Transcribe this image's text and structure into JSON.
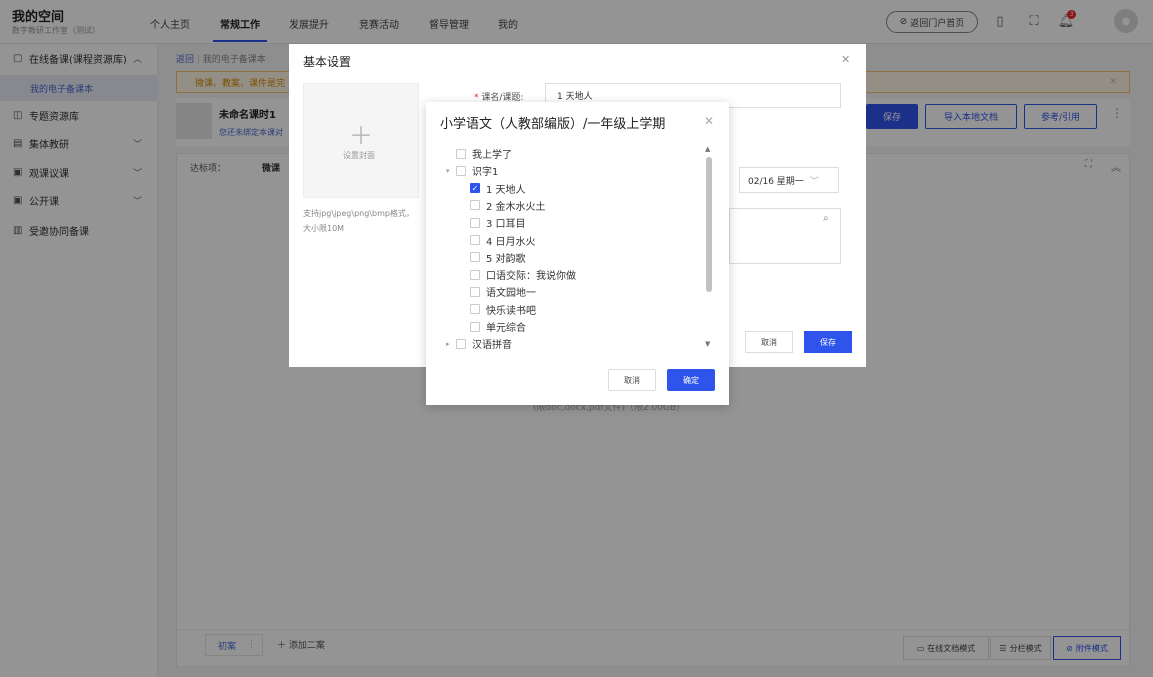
{
  "brand": {
    "title": "我的空间",
    "subtitle": "数字教研工作室（测试）"
  },
  "nav": [
    "个人主页",
    "常规工作",
    "发展提升",
    "竞赛活动",
    "督导管理",
    "我的"
  ],
  "header": {
    "portal_button": "返回门户首页",
    "notification_count": "3"
  },
  "sidebar": {
    "items": [
      {
        "label": "在线备课(课程资源库)",
        "icon": "document-icon"
      },
      {
        "label": "专题资源库",
        "icon": "topic-icon"
      },
      {
        "label": "集体教研",
        "icon": "list-icon"
      },
      {
        "label": "观课议课",
        "icon": "observe-icon"
      },
      {
        "label": "公开课",
        "icon": "presentation-icon"
      },
      {
        "label": "受邀协同备课",
        "icon": "team-icon"
      }
    ],
    "sub_item": "我的电子备课本"
  },
  "breadcrumb": {
    "back": "返回",
    "current": "我的电子备课本"
  },
  "notice": {
    "text": "微课、教案、课件是完"
  },
  "lesson": {
    "title": "未命名课时1",
    "subtitle": "您还未绑定本课对"
  },
  "actions": {
    "save": "保存",
    "import": "导入本地文档",
    "reference": "参考/引用"
  },
  "workarea": {
    "label": "达标项：",
    "tag": "微课",
    "upload_hint": "(限doc,docx,pdf文件)（限2.00GB）"
  },
  "bottom": {
    "tab": "初案",
    "add_tab": "添加二案",
    "modes": [
      "在线文档模式",
      "分栏模式",
      "附件模式"
    ]
  },
  "basic_dialog": {
    "title": "基本设置",
    "cover_label": "设置封面",
    "cover_hint_1": "支持jpg\\jpeg\\png\\bmp格式，",
    "cover_hint_2": "大小限10M",
    "field_label": "课名/课题:",
    "field_value": "1 天地人",
    "date_value": "02/16 星期一",
    "cancel": "取消",
    "save": "保存"
  },
  "tree_dialog": {
    "title": "小学语文（人教部编版）/一年级上学期",
    "items": [
      {
        "label": "我上学了",
        "level": 1,
        "caret": "",
        "checked": false
      },
      {
        "label": "识字1",
        "level": 1,
        "caret": "▾",
        "checked": false
      },
      {
        "label": "1 天地人",
        "level": 2,
        "caret": "",
        "checked": true
      },
      {
        "label": "2 金木水火土",
        "level": 2,
        "caret": "",
        "checked": false
      },
      {
        "label": "3 口耳目",
        "level": 2,
        "caret": "",
        "checked": false
      },
      {
        "label": "4 日月水火",
        "level": 2,
        "caret": "",
        "checked": false
      },
      {
        "label": "5 对韵歌",
        "level": 2,
        "caret": "",
        "checked": false
      },
      {
        "label": "口语交际：我说你做",
        "level": 2,
        "caret": "",
        "checked": false
      },
      {
        "label": "语文园地一",
        "level": 2,
        "caret": "",
        "checked": false
      },
      {
        "label": "快乐读书吧",
        "level": 2,
        "caret": "",
        "checked": false
      },
      {
        "label": "单元综合",
        "level": 2,
        "caret": "",
        "checked": false
      },
      {
        "label": "汉语拼音",
        "level": 1,
        "caret": "▸",
        "checked": false
      }
    ],
    "cancel": "取消",
    "confirm": "确定"
  },
  "colors": {
    "primary": "#2f54eb",
    "notice_border": "#f5c26b",
    "notice_text": "#d48806"
  }
}
